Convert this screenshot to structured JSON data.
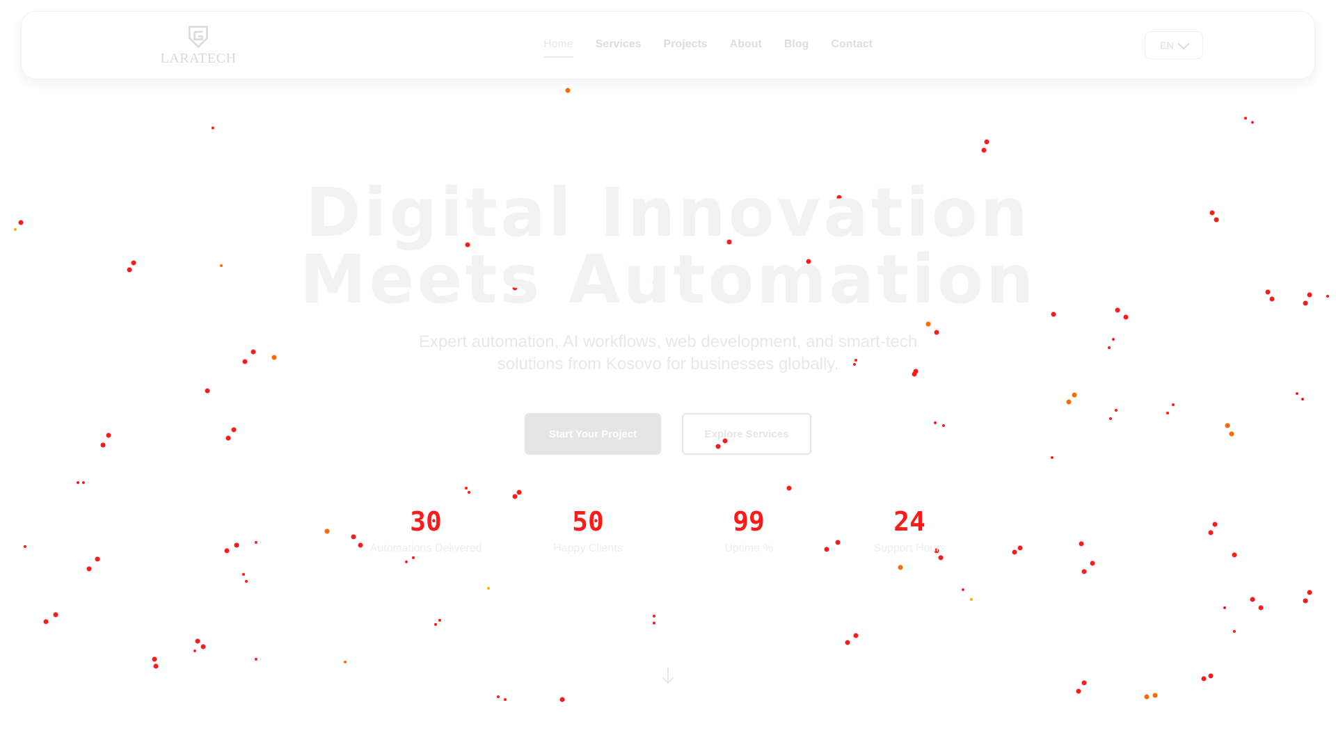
{
  "brand": {
    "logo_text": "LARATECH"
  },
  "nav": {
    "items": [
      {
        "label": "Home",
        "active": true
      },
      {
        "label": "Services",
        "active": false
      },
      {
        "label": "Projects",
        "active": false
      },
      {
        "label": "About",
        "active": false
      },
      {
        "label": "Blog",
        "active": false
      },
      {
        "label": "Contact",
        "active": false
      }
    ],
    "language": "EN"
  },
  "hero": {
    "title_line1": "Digital Innovation",
    "title_line2": "Meets Automation",
    "subtitle_line1": "Expert automation, AI workflows, web development, and smart-tech",
    "subtitle_line2": "solutions from Kosovo for businesses globally.",
    "primary_cta": "Start Your Project",
    "secondary_cta": "Explore Services"
  },
  "stats": [
    {
      "value": "30",
      "label": "Automations Delivered"
    },
    {
      "value": "50",
      "label": "Happy Clients"
    },
    {
      "value": "99",
      "label": "Uptime %"
    },
    {
      "value": "24",
      "label": "Support Hours"
    }
  ],
  "icons": {
    "scroll": "arrow-down-icon",
    "language": "chevron-down-icon",
    "logo": "shield-logo-icon"
  },
  "colors": {
    "accent": "#ff1a1a",
    "muted_text": "#e6e6e6"
  }
}
